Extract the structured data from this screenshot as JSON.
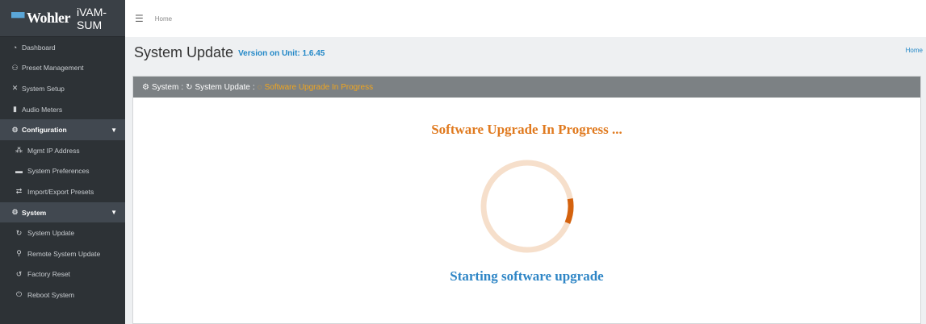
{
  "brand": {
    "logo": "Wohler",
    "product": "iVAM-SUM"
  },
  "sidebar": {
    "items": [
      {
        "icon": "dashboard-icon",
        "label": "Dashboard"
      },
      {
        "icon": "preset-icon",
        "label": "Preset Management"
      },
      {
        "icon": "tools-icon",
        "label": "System Setup"
      },
      {
        "icon": "meters-icon",
        "label": "Audio Meters"
      }
    ],
    "groups": [
      {
        "icon": "gear-icon",
        "label": "Configuration",
        "items": [
          {
            "icon": "network-icon",
            "label": "Mgmt IP Address"
          },
          {
            "icon": "toggle-icon",
            "label": "System Preferences"
          },
          {
            "icon": "swap-icon",
            "label": "Import/Export Presets"
          }
        ]
      },
      {
        "icon": "gears-icon",
        "label": "System",
        "items": [
          {
            "icon": "refresh-icon",
            "label": "System Update"
          },
          {
            "icon": "remote-icon",
            "label": "Remote System Update"
          },
          {
            "icon": "undo-icon",
            "label": "Factory Reset"
          },
          {
            "icon": "power-icon",
            "label": "Reboot System"
          }
        ]
      }
    ]
  },
  "topbar": {
    "home_label": "Home"
  },
  "header": {
    "title": "System Update",
    "version_label": "Version on Unit: 1.6.45",
    "breadcrumb_home": "Home"
  },
  "card": {
    "crumb_system": "System",
    "crumb_update": "System Update",
    "crumb_current": "Software Upgrade In Progress",
    "separator": ":"
  },
  "progress": {
    "title": "Software Upgrade In Progress ...",
    "status": "Starting software upgrade",
    "arc_fraction": 0.09
  },
  "colors": {
    "sidebar_bg": "#2d3236",
    "accent_orange": "#e07a1f",
    "accent_blue": "#2187c7",
    "ring_track": "#f6dfcb",
    "ring_arc": "#d4620e"
  }
}
